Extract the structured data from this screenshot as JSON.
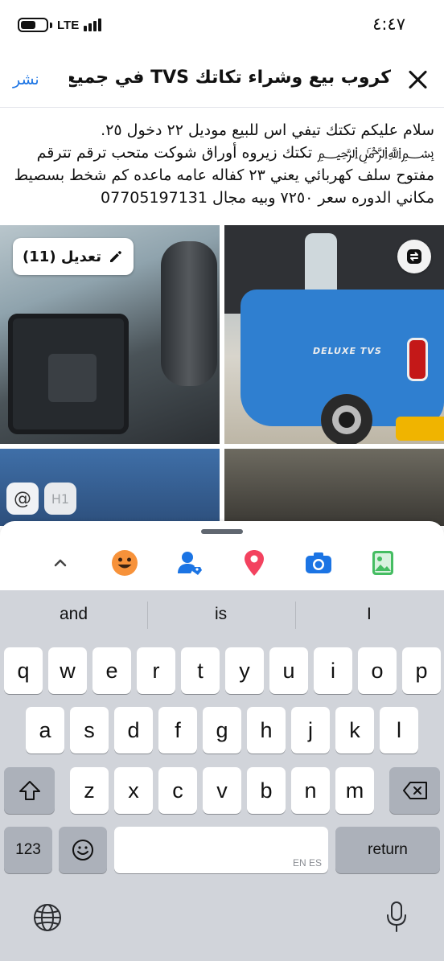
{
  "status_bar": {
    "time": "٤:٤٧",
    "network": "LTE"
  },
  "header": {
    "title": "كروب بيع وشراء تكاتك TVS في جميع المح...",
    "post_label": "نشر"
  },
  "post": {
    "text": "سلام عليكم تكتك تيفي اس للبيع موديل ٢٢ دخول ٢٥. ﷽ تكتك زيروه أوراق شوكت متحب ترقم تترقم مفتوح سلف كهربائي  يعني ٢٣  كفاله عامه ماعده كم شخط بسصيط مكاني الدوره سعر ٧٢٥٠ وبيه مجال  07705197131"
  },
  "media": {
    "edit_label": "تعديل (11)",
    "decal_text": "DELUXE TVS"
  },
  "chips": {
    "at": "@",
    "h1": "H1"
  },
  "keyboard": {
    "suggestions": [
      "and",
      "is",
      "I"
    ],
    "row1": [
      "q",
      "w",
      "e",
      "r",
      "t",
      "y",
      "u",
      "i",
      "o",
      "p"
    ],
    "row2": [
      "a",
      "s",
      "d",
      "f",
      "g",
      "h",
      "j",
      "k",
      "l"
    ],
    "row3": [
      "z",
      "x",
      "c",
      "v",
      "b",
      "n",
      "m"
    ],
    "numbers_label": "123",
    "space_hint": "EN ES",
    "return_label": "return"
  },
  "colors": {
    "accent": "#1b74e4",
    "emoji": "#f7923a",
    "tag_people": "#1b74e4",
    "location": "#f3425f",
    "camera": "#1b74e4",
    "photo": "#45bd62"
  }
}
